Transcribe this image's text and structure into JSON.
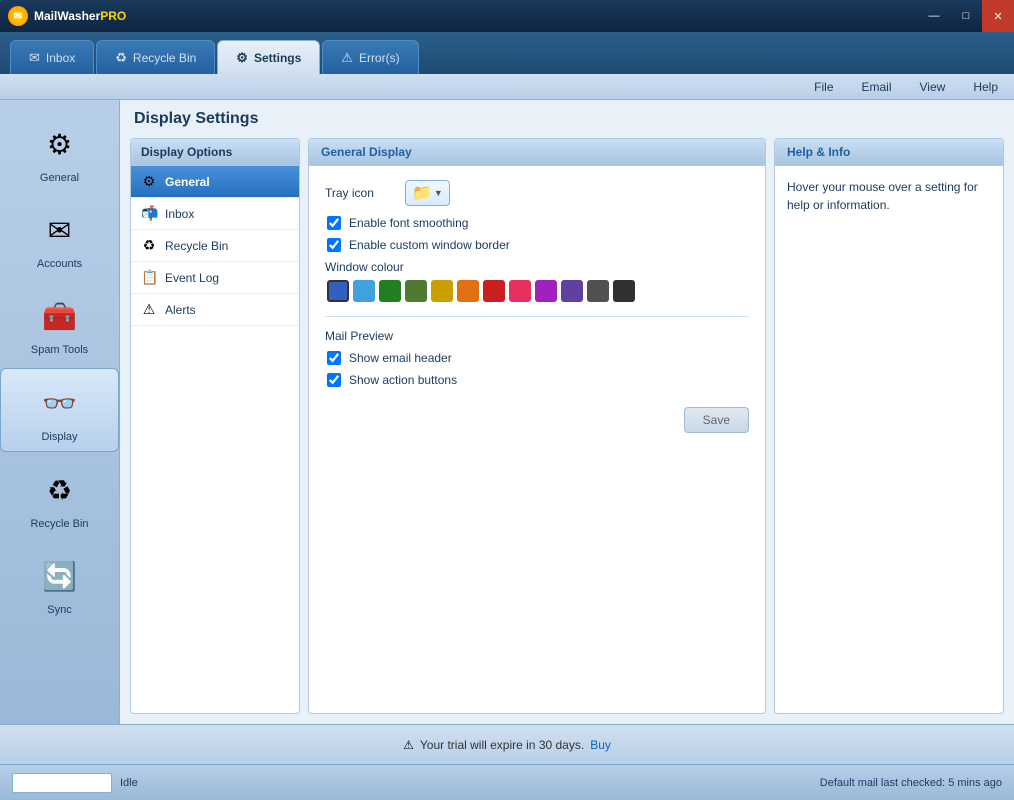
{
  "app": {
    "name": "MailWasher",
    "name_pro": "PRO",
    "logo": "✉"
  },
  "window_controls": {
    "minimize": "—",
    "maximize": "□",
    "close": "✕"
  },
  "tabs": [
    {
      "id": "inbox",
      "label": "Inbox",
      "icon": "✉",
      "active": false
    },
    {
      "id": "recycle",
      "label": "Recycle Bin",
      "icon": "♻",
      "active": false
    },
    {
      "id": "settings",
      "label": "Settings",
      "icon": "⚙",
      "active": true
    },
    {
      "id": "errors",
      "label": "Error(s)",
      "icon": "⚠",
      "active": false
    }
  ],
  "menu": {
    "items": [
      "File",
      "Email",
      "View",
      "Help"
    ]
  },
  "sidebar": {
    "items": [
      {
        "id": "general",
        "label": "General",
        "icon": "⚙",
        "active": false
      },
      {
        "id": "accounts",
        "label": "Accounts",
        "icon": "✉",
        "active": false
      },
      {
        "id": "spam-tools",
        "label": "Spam Tools",
        "icon": "🧰",
        "active": false
      },
      {
        "id": "display",
        "label": "Display",
        "icon": "👓",
        "active": true
      },
      {
        "id": "recycle-bin",
        "label": "Recycle Bin",
        "icon": "♻",
        "active": false
      },
      {
        "id": "sync",
        "label": "Sync",
        "icon": "🔄",
        "active": false
      }
    ]
  },
  "settings": {
    "title": "Display Settings",
    "options_header": "Display Options",
    "option_items": [
      {
        "id": "general",
        "label": "General",
        "icon": "⚙",
        "active": true
      },
      {
        "id": "inbox",
        "label": "Inbox",
        "icon": "📬",
        "active": false
      },
      {
        "id": "recycle-bin",
        "label": "Recycle Bin",
        "icon": "♻",
        "active": false
      },
      {
        "id": "event-log",
        "label": "Event Log",
        "icon": "📋",
        "active": false
      },
      {
        "id": "alerts",
        "label": "Alerts",
        "icon": "⚠",
        "active": false
      }
    ],
    "general_display": {
      "header": "General Display",
      "tray_icon_label": "Tray icon",
      "enable_font_smoothing_label": "Enable font smoothing",
      "enable_font_smoothing_checked": true,
      "enable_custom_border_label": "Enable custom window border",
      "enable_custom_border_checked": true,
      "window_colour_label": "Window colour",
      "colors": [
        {
          "hex": "#3060c0",
          "selected": true
        },
        {
          "hex": "#40a0e0",
          "selected": false
        },
        {
          "hex": "#208020",
          "selected": false
        },
        {
          "hex": "#507a30",
          "selected": false
        },
        {
          "hex": "#c8a000",
          "selected": false
        },
        {
          "hex": "#e07010",
          "selected": false
        },
        {
          "hex": "#c82020",
          "selected": false
        },
        {
          "hex": "#e83060",
          "selected": false
        },
        {
          "hex": "#a020c0",
          "selected": false
        },
        {
          "hex": "#6040a0",
          "selected": false
        },
        {
          "hex": "#505050",
          "selected": false
        },
        {
          "hex": "#303030",
          "selected": false
        }
      ],
      "mail_preview_label": "Mail Preview",
      "show_email_header_label": "Show email header",
      "show_email_header_checked": true,
      "show_action_buttons_label": "Show action buttons",
      "show_action_buttons_checked": true,
      "save_button": "Save"
    },
    "help": {
      "header": "Help & Info",
      "content": "Hover your mouse over a setting for help or information."
    }
  },
  "bottom_bar": {
    "warning_icon": "⚠",
    "trial_text": "Your trial will expire in 30 days.",
    "buy_label": "Buy"
  },
  "status_bar": {
    "input_placeholder": "",
    "status_text": "Idle",
    "last_checked": "Default mail last checked: 5 mins ago"
  }
}
